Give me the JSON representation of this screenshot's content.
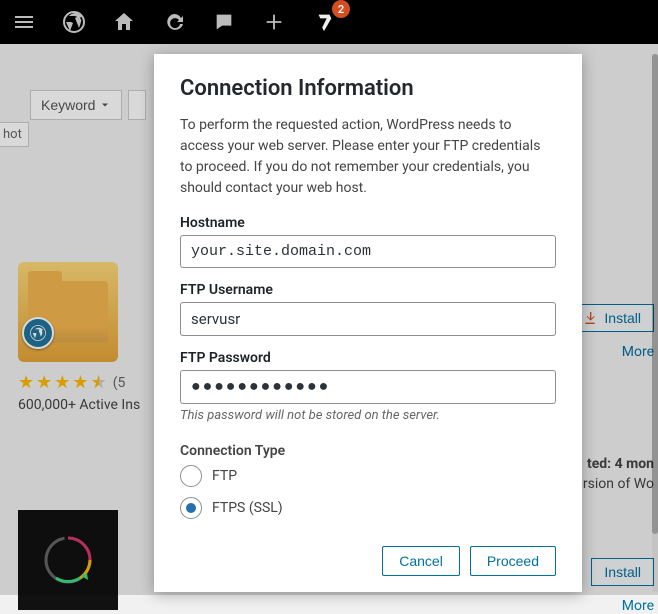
{
  "adminbar": {
    "notif_count": "2"
  },
  "bg": {
    "filter_hot": "hot",
    "filter_keyword": "Keyword",
    "stars_count": "(5",
    "installs": "600,000+ Active Ins",
    "install_btn": "Install",
    "more": "More",
    "updated": "ted: 4 mon",
    "version": "rsion of Wo"
  },
  "modal": {
    "title": "Connection Information",
    "intro": "To perform the requested action, WordPress needs to access your web server. Please enter your FTP credentials to proceed. If you do not remember your credentials, you should contact your web host.",
    "hostname_label": "Hostname",
    "hostname_value": "your.site.domain.com",
    "username_label": "FTP Username",
    "username_value": "servusr",
    "password_label": "FTP Password",
    "password_value": "●●●●●●●●●●●●",
    "password_hint": "This password will not be stored on the server.",
    "conntype_label": "Connection Type",
    "conn_ftp": "FTP",
    "conn_ftps": "FTPS (SSL)",
    "cancel": "Cancel",
    "proceed": "Proceed"
  }
}
